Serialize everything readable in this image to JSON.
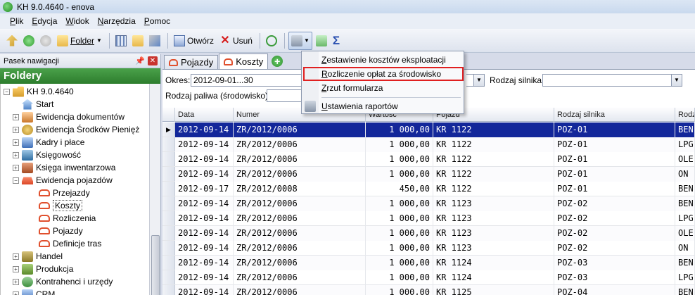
{
  "window": {
    "title": "KH 9.0.4640 - enova"
  },
  "menu": [
    "Plik",
    "Edycja",
    "Widok",
    "Narzędzia",
    "Pomoc"
  ],
  "toolbar": {
    "folder_label": "Folder",
    "open_label": "Otwórz",
    "delete_label": "Usuń"
  },
  "nav": {
    "header": "Pasek nawigacji",
    "folders_title": "Foldery",
    "items": [
      {
        "label": "KH 9.0.4640",
        "icon": "database-icon"
      },
      {
        "label": "Start",
        "icon": "home-icon"
      },
      {
        "label": "Ewidencja dokumentów",
        "icon": "documents-icon"
      },
      {
        "label": "Ewidencja Środków Pienięż",
        "icon": "coins-icon"
      },
      {
        "label": "Kadry i płace",
        "icon": "people-icon"
      },
      {
        "label": "Księgowość",
        "icon": "book-icon"
      },
      {
        "label": "Księga inwentarzowa",
        "icon": "box-icon"
      },
      {
        "label": "Ewidencja pojazdów",
        "icon": "car-icon"
      },
      {
        "label": "Przejazdy",
        "icon": "car-icon"
      },
      {
        "label": "Koszty",
        "icon": "car-icon"
      },
      {
        "label": "Rozliczenia",
        "icon": "car-icon"
      },
      {
        "label": "Pojazdy",
        "icon": "car-icon"
      },
      {
        "label": "Definicje tras",
        "icon": "car-icon"
      },
      {
        "label": "Handel",
        "icon": "trade-icon"
      },
      {
        "label": "Produkcja",
        "icon": "production-icon"
      },
      {
        "label": "Kontrahenci i urzędy",
        "icon": "contractors-icon"
      },
      {
        "label": "CRM",
        "icon": "crm-icon"
      }
    ]
  },
  "tabs": [
    {
      "label": "Pojazdy"
    },
    {
      "label": "Koszty"
    }
  ],
  "filters": {
    "okres_label": "Okres:",
    "okres_value": "2012-09-01...30",
    "rodzaj_silnika_label": "Rodzaj silnika:",
    "rodzaj_silnika_value": "",
    "rodzaj_paliwa_label": "Rodzaj paliwa (środowisko):",
    "rodzaj_paliwa_value": ""
  },
  "dropdown": {
    "items": [
      "Zestawienie kosztów eksploatacji",
      "Rozliczenie opłat za środowisko",
      "Zrzut formularza",
      "Ustawienia raportów"
    ]
  },
  "grid": {
    "columns": [
      "Data",
      "Numer",
      "Wartość",
      "Pojazd",
      "Rodzaj silnika",
      "Rodz"
    ],
    "rows": [
      {
        "data": "2012-09-14",
        "numer": "ZR/2012/0006",
        "wartosc": "1 000,00",
        "pojazd": "KR 1122",
        "silnik": "POZ-01",
        "paliwo": "BEN"
      },
      {
        "data": "2012-09-14",
        "numer": "ZR/2012/0006",
        "wartosc": "1 000,00",
        "pojazd": "KR 1122",
        "silnik": "POZ-01",
        "paliwo": "LPG"
      },
      {
        "data": "2012-09-14",
        "numer": "ZR/2012/0006",
        "wartosc": "1 000,00",
        "pojazd": "KR 1122",
        "silnik": "POZ-01",
        "paliwo": "OLE"
      },
      {
        "data": "2012-09-14",
        "numer": "ZR/2012/0006",
        "wartosc": "1 000,00",
        "pojazd": "KR 1122",
        "silnik": "POZ-01",
        "paliwo": "ON"
      },
      {
        "data": "2012-09-17",
        "numer": "ZR/2012/0008",
        "wartosc": "450,00",
        "pojazd": "KR 1122",
        "silnik": "POZ-01",
        "paliwo": "BEN"
      },
      {
        "data": "2012-09-14",
        "numer": "ZR/2012/0006",
        "wartosc": "1 000,00",
        "pojazd": "KR 1123",
        "silnik": "POZ-02",
        "paliwo": "BEN"
      },
      {
        "data": "2012-09-14",
        "numer": "ZR/2012/0006",
        "wartosc": "1 000,00",
        "pojazd": "KR 1123",
        "silnik": "POZ-02",
        "paliwo": "LPG"
      },
      {
        "data": "2012-09-14",
        "numer": "ZR/2012/0006",
        "wartosc": "1 000,00",
        "pojazd": "KR 1123",
        "silnik": "POZ-02",
        "paliwo": "OLE"
      },
      {
        "data": "2012-09-14",
        "numer": "ZR/2012/0006",
        "wartosc": "1 000,00",
        "pojazd": "KR 1123",
        "silnik": "POZ-02",
        "paliwo": "ON"
      },
      {
        "data": "2012-09-14",
        "numer": "ZR/2012/0006",
        "wartosc": "1 000,00",
        "pojazd": "KR 1124",
        "silnik": "POZ-03",
        "paliwo": "BEN"
      },
      {
        "data": "2012-09-14",
        "numer": "ZR/2012/0006",
        "wartosc": "1 000,00",
        "pojazd": "KR 1124",
        "silnik": "POZ-03",
        "paliwo": "LPG"
      },
      {
        "data": "2012-09-14",
        "numer": "ZR/2012/0006",
        "wartosc": "1 000,00",
        "pojazd": "KR 1125",
        "silnik": "POZ-04",
        "paliwo": "BEN"
      }
    ]
  }
}
